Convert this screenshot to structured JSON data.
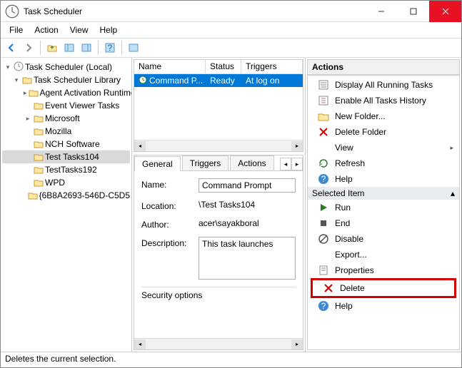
{
  "window": {
    "title": "Task Scheduler"
  },
  "menu": {
    "file": "File",
    "action": "Action",
    "view": "View",
    "help": "Help"
  },
  "tree": {
    "root": "Task Scheduler (Local)",
    "library": "Task Scheduler Library",
    "items": [
      "Agent Activation Runtime",
      "Event Viewer Tasks",
      "Microsoft",
      "Mozilla",
      "NCH Software",
      "Test Tasks104",
      "TestTasks192",
      "WPD",
      "{6B8A2693-546D-C5D5"
    ]
  },
  "tasklist": {
    "cols": {
      "name": "Name",
      "status": "Status",
      "triggers": "Triggers"
    },
    "row": {
      "name": "Command P...",
      "status": "Ready",
      "triggers": "At log on"
    }
  },
  "details": {
    "tabs": {
      "general": "General",
      "triggers": "Triggers",
      "actions": "Actions"
    },
    "name_label": "Name:",
    "name_value": "Command Prompt",
    "location_label": "Location:",
    "location_value": "\\Test Tasks104",
    "author_label": "Author:",
    "author_value": "acer\\sayakboral",
    "desc_label": "Description:",
    "desc_value": "This task launches",
    "security_label": "Security options"
  },
  "actions": {
    "header": "Actions",
    "group1": [
      "Display All Running Tasks",
      "Enable All Tasks History",
      "New Folder...",
      "Delete Folder",
      "View",
      "Refresh",
      "Help"
    ],
    "section2": "Selected Item",
    "group2": [
      "Run",
      "End",
      "Disable",
      "Export...",
      "Properties",
      "Delete",
      "Help"
    ]
  },
  "status": "Deletes the current selection."
}
